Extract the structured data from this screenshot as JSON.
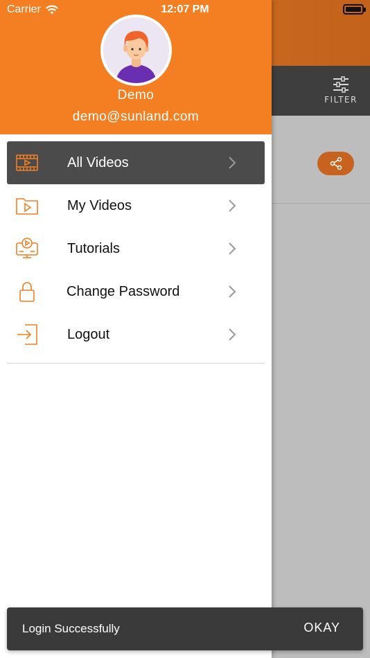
{
  "status_bar": {
    "carrier": "Carrier",
    "time": "12:07 PM"
  },
  "background": {
    "filter_label": "FILTER"
  },
  "profile": {
    "name": "Demo",
    "email": "demo@sunland.com"
  },
  "menu": {
    "items": [
      {
        "label": "All Videos",
        "icon": "film-icon",
        "active": true
      },
      {
        "label": "My Videos",
        "icon": "video-folder-icon",
        "active": false
      },
      {
        "label": "Tutorials",
        "icon": "tutorial-monitor-icon",
        "active": false
      },
      {
        "label": "Change Password",
        "icon": "lock-icon",
        "active": false
      },
      {
        "label": "Logout",
        "icon": "logout-icon",
        "active": false
      }
    ]
  },
  "snackbar": {
    "message": "Login Successfully",
    "action": "OKAY"
  },
  "colors": {
    "accent": "#f47f22",
    "active_item": "#4b4b4b",
    "snackbar": "#3a3a3a"
  }
}
